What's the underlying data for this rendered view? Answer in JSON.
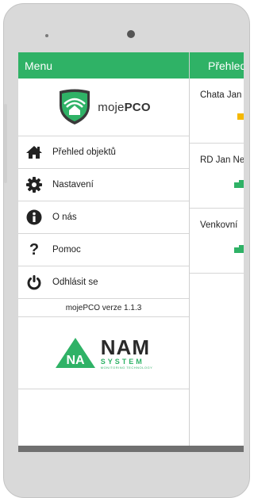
{
  "drawer": {
    "title": "Menu",
    "logo_text_light": "moje",
    "logo_text_bold": "PCO",
    "items": [
      {
        "label": "Přehled objektů",
        "icon": "home-icon"
      },
      {
        "label": "Nastavení",
        "icon": "gear-icon"
      },
      {
        "label": "O nás",
        "icon": "info-icon"
      },
      {
        "label": "Pomoc",
        "icon": "question-icon"
      },
      {
        "label": "Odhlásit se",
        "icon": "power-icon"
      }
    ],
    "version": "mojePCO verze 1.1.3",
    "partner_logo": {
      "name": "NAM",
      "line2": "SYSTEM",
      "tagline": "MONITORING TECHNOLOGY"
    }
  },
  "main": {
    "title": "Přehled objektů",
    "objects": [
      {
        "name": "Chata Jan",
        "status_color": "#f5b800"
      },
      {
        "name": "RD Jan Ne",
        "status_color": "#2fb266"
      },
      {
        "name": "Venkovní",
        "status_color": "#2fb266"
      }
    ]
  },
  "colors": {
    "accent": "#2fb266",
    "warning": "#f5b800"
  }
}
